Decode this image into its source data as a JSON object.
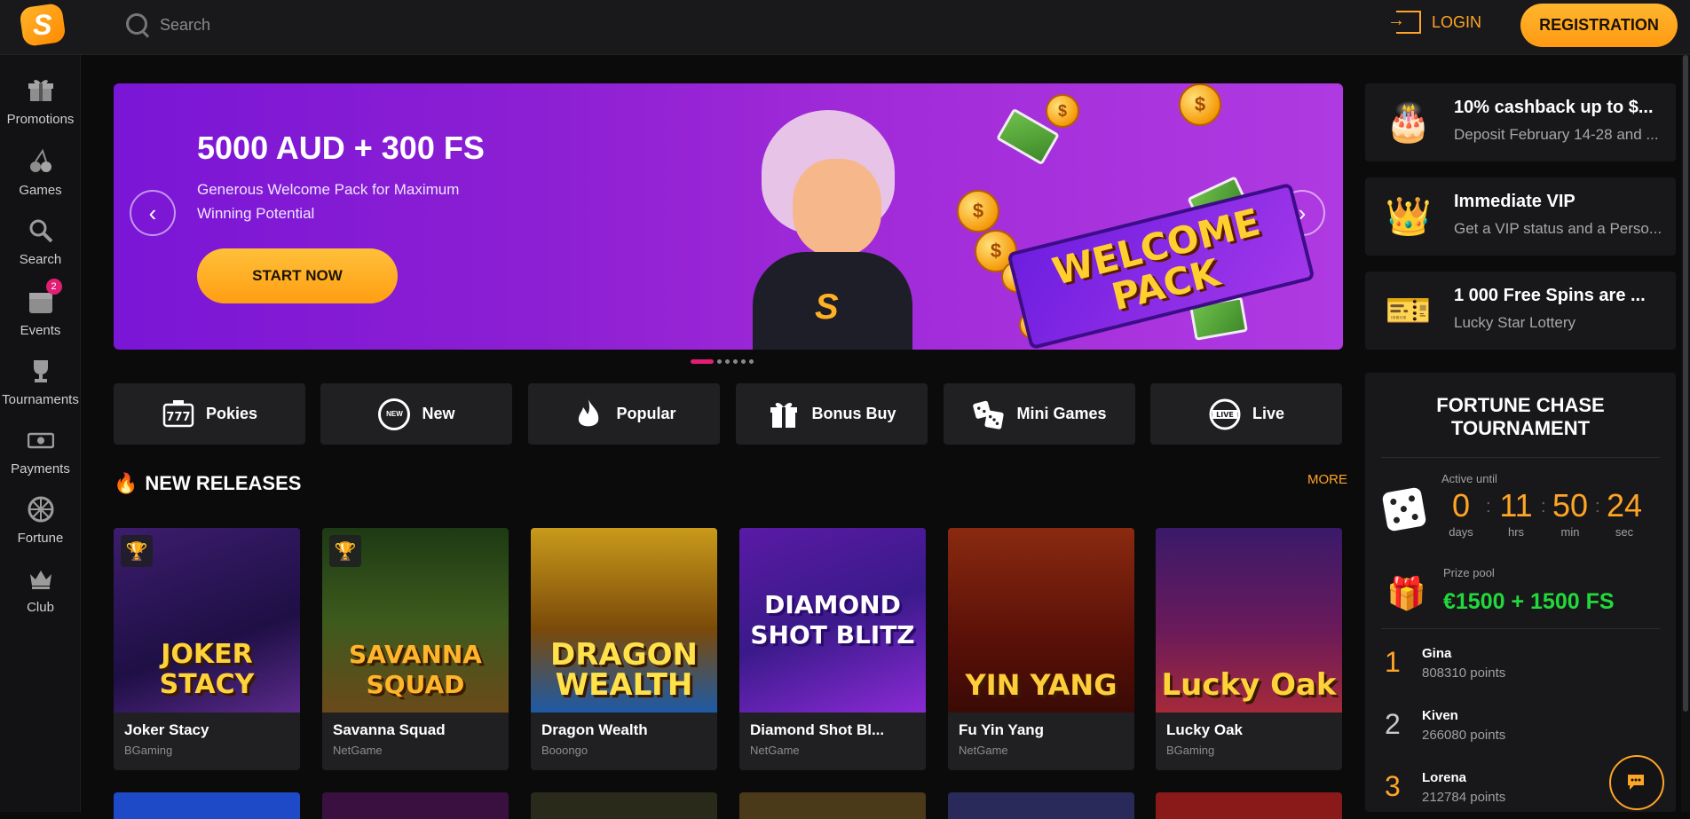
{
  "header": {
    "logo_letter": "S",
    "search_placeholder": "Search",
    "login_label": "LOGIN",
    "registration_label": "REGISTRATION"
  },
  "sidebar": {
    "items": [
      {
        "label": "Promotions",
        "icon": "gift-icon"
      },
      {
        "label": "Games",
        "icon": "cherries-icon"
      },
      {
        "label": "Search",
        "icon": "search-icon"
      },
      {
        "label": "Events",
        "icon": "calendar-icon",
        "badge": "2"
      },
      {
        "label": "Tournaments",
        "icon": "trophy-icon"
      },
      {
        "label": "Payments",
        "icon": "cash-icon"
      },
      {
        "label": "Fortune",
        "icon": "wheel-icon"
      },
      {
        "label": "Club",
        "icon": "crown-icon"
      }
    ]
  },
  "banner": {
    "title": "5000 AUD + 300 FS",
    "subtitle": "Generous Welcome Pack for Maximum Winning Potential",
    "cta": "START NOW",
    "sign_text": "WELCOME PACK",
    "slide_count": 6,
    "active_slide": 1
  },
  "categories": [
    {
      "label": "Pokies",
      "icon": "slot-777-icon"
    },
    {
      "label": "New",
      "icon": "new-badge-icon"
    },
    {
      "label": "Popular",
      "icon": "flame-icon"
    },
    {
      "label": "Bonus Buy",
      "icon": "gift-icon"
    },
    {
      "label": "Mini Games",
      "icon": "dice-icon"
    },
    {
      "label": "Live",
      "icon": "live-icon"
    }
  ],
  "new_releases": {
    "title": "NEW RELEASES",
    "more_label": "MORE",
    "games": [
      {
        "name": "Joker Stacy",
        "provider": "BGaming",
        "art": "JOKER STACY",
        "trophy": true
      },
      {
        "name": "Savanna Squad",
        "provider": "NetGame",
        "art": "SAVANNA SQUAD",
        "trophy": true
      },
      {
        "name": "Dragon Wealth",
        "provider": "Booongo",
        "art": "DRAGON WEALTH",
        "trophy": false
      },
      {
        "name": "Diamond Shot Bl...",
        "provider": "NetGame",
        "art": "DIAMOND SHOT BLITZ",
        "trophy": false
      },
      {
        "name": "Fu Yin Yang",
        "provider": "NetGame",
        "art": "YIN YANG",
        "trophy": false
      },
      {
        "name": "Lucky Oak",
        "provider": "BGaming",
        "art": "Lucky Oak",
        "trophy": false
      }
    ]
  },
  "promos": [
    {
      "title": "10% cashback up to $...",
      "subtitle": "Deposit February 14-28 and ...",
      "icon": "cake-icon"
    },
    {
      "title": "Immediate VIP",
      "subtitle": "Get a VIP status and a Perso...",
      "icon": "crown-icon"
    },
    {
      "title": "1 000 Free Spins are ...",
      "subtitle": "Lucky Star Lottery",
      "icon": "lottery-ticket-icon"
    }
  ],
  "tournament": {
    "title": "FORTUNE CHASE TOURNAMENT",
    "active_until_label": "Active until",
    "countdown": [
      {
        "value": "0",
        "unit": "days"
      },
      {
        "value": "11",
        "unit": "hrs"
      },
      {
        "value": "50",
        "unit": "min"
      },
      {
        "value": "24",
        "unit": "sec"
      }
    ],
    "prize_pool_label": "Prize pool",
    "prize_pool": "€1500 + 1500 FS",
    "leaderboard": [
      {
        "rank": "1",
        "name": "Gina",
        "points": "808310 points"
      },
      {
        "rank": "2",
        "name": "Kiven",
        "points": "266080 points"
      },
      {
        "rank": "3",
        "name": "Lorena",
        "points": "212784 points"
      }
    ]
  },
  "colors": {
    "accent": "#ffa526",
    "badge": "#e11e73",
    "prize": "#22d93b",
    "banner": "#8d1fd3"
  }
}
